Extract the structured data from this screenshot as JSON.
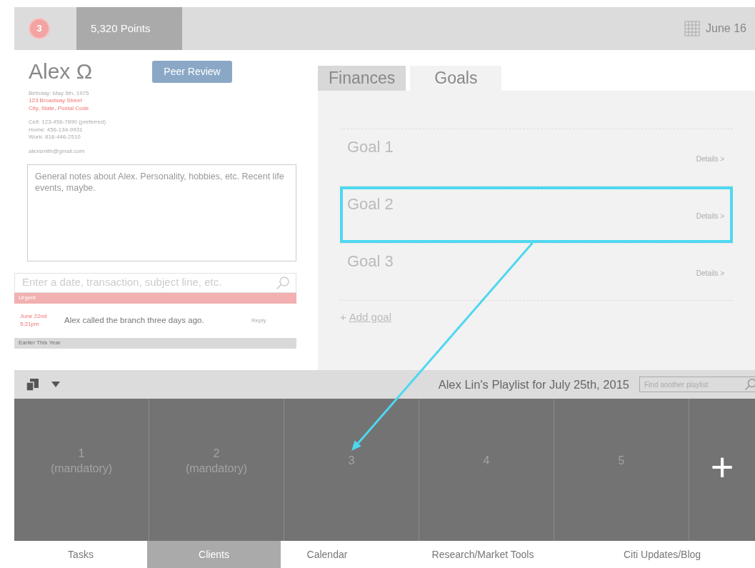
{
  "header": {
    "notification_count": "3",
    "points": "5,320 Points",
    "date": "June 16"
  },
  "profile": {
    "name": "Alex Ω",
    "peer_review_button": "Peer Review",
    "birthday": "Birthday: May 5th, 1975",
    "address_lines": [
      "123 Broadway Street",
      "City, State, Postal Code"
    ],
    "phones": [
      {
        "label": "Cell:",
        "number": "123-456-7890",
        "note": "(preferred)"
      },
      {
        "label": "Home:",
        "number": "456-134-9931"
      },
      {
        "label": "Work:",
        "number": "818-446-2510"
      }
    ],
    "email": "alexsmith@gmail.com",
    "notes": "General notes about Alex. Personality, hobbies, etc. Recent life events, maybe.",
    "search": {
      "placeholder": "Enter a date, transaction, subject line, etc."
    }
  },
  "activity": [
    {
      "kind": "header",
      "label": "Urgent",
      "color": "#f2b0b0"
    },
    {
      "kind": "entry",
      "date": "June 22nd",
      "time": "5:21pm",
      "text": "Alex called the branch three days ago.",
      "action": "Reply"
    },
    {
      "kind": "header",
      "label": "Earlier This Year",
      "color": "#d9d9d9"
    }
  ],
  "tabs": [
    {
      "label": "Finances",
      "selected": false
    },
    {
      "label": "Goals",
      "selected": true
    }
  ],
  "goals": [
    {
      "title": "Goal 1",
      "details": "Details >",
      "highlighted": false
    },
    {
      "title": "Goal 2",
      "details": "Details >",
      "highlighted": true
    },
    {
      "title": "Goal 3",
      "details": "Details >",
      "highlighted": false
    }
  ],
  "add_goal": {
    "icon": "+",
    "label": "Add goal"
  },
  "playlist": {
    "title": "Alex Lin's Playlist for July 25th, 2015",
    "search": {
      "placeholder": "Find another playlist"
    },
    "slots": [
      {
        "kind": "slot",
        "number": "1",
        "note": "(mandatory)",
        "target": false
      },
      {
        "kind": "slot",
        "number": "2",
        "note": "(mandatory)",
        "target": false
      },
      {
        "kind": "slot",
        "number": "3",
        "target": true
      },
      {
        "kind": "slot",
        "number": "4",
        "target": false
      },
      {
        "kind": "slot",
        "number": "5",
        "target": false
      },
      {
        "kind": "add",
        "label": "+"
      }
    ]
  },
  "bottom_nav": [
    {
      "label": "Tasks",
      "selected": false
    },
    {
      "label": "Clients",
      "selected": true
    },
    {
      "label": "Calendar",
      "selected": false
    },
    {
      "label": "Research/Market Tools",
      "selected": false
    },
    {
      "label": "Citi Updates/Blog",
      "selected": false
    }
  ]
}
